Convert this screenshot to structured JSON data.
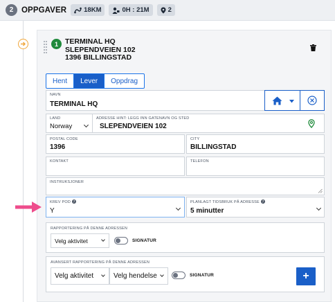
{
  "header": {
    "step_number": "2",
    "title": "OPPGAVER",
    "distance": "18KM",
    "duration": "0H : 21M",
    "stops": "2"
  },
  "stop": {
    "number": "1",
    "name": "TERMINAL HQ",
    "street": "SLEPENDVEIEN 102",
    "postal_city": "1396 BILLINGSTAD"
  },
  "tabs": [
    {
      "label": "Hent"
    },
    {
      "label": "Lever"
    },
    {
      "label": "Oppdrag"
    }
  ],
  "form": {
    "name_label": "NAVN",
    "name_value": "TERMINAL HQ",
    "country_label": "LAND",
    "country_value": "Norway",
    "address_label": "ADRESSE HINT: LEGG INN GATENAVN OG STED",
    "address_value": "SLEPENDVEIEN 102",
    "postal_label": "POSTAL CODE",
    "postal_value": "1396",
    "city_label": "CITY",
    "city_value": "BILLINGSTAD",
    "contact_label": "KONTAKT",
    "contact_value": "",
    "phone_label": "TELEFON",
    "phone_value": "",
    "instructions_label": "INSTRUKSJONER",
    "instructions_value": "",
    "pod_label": "KREV POD",
    "pod_value": "Y",
    "time_label": "PLANLAGT TIDSBRUK PÅ ADRESSE",
    "time_value": "5 minutter"
  },
  "reporting": {
    "label": "RAPPORTERING PÅ DENNE ADRESSEN",
    "activity_select": "Velg aktivitet",
    "signature_label": "SIGNATUR"
  },
  "advanced_reporting": {
    "label": "AVANSERT RAPPORTERING PÅ DENNE ADRESSEN",
    "activity_select": "Velg aktivitet",
    "event_select": "Velg hendelse",
    "signature_label": "SIGNATUR",
    "add_label": "+"
  },
  "colors": {
    "accent_blue": "#1a5fc8",
    "stop_green": "#1f8a3b",
    "arrow_orange": "#f0a63a",
    "pointer_pink": "#ee4d8c",
    "pin_green": "#1f8a3b"
  },
  "icons": [
    "route-icon",
    "driver-icon",
    "location-pin-icon",
    "arrow-right-icon",
    "drag-handle-icon",
    "trash-icon",
    "home-icon",
    "clear-icon",
    "help-icon",
    "pointer-arrow-icon",
    "plus-icon"
  ]
}
